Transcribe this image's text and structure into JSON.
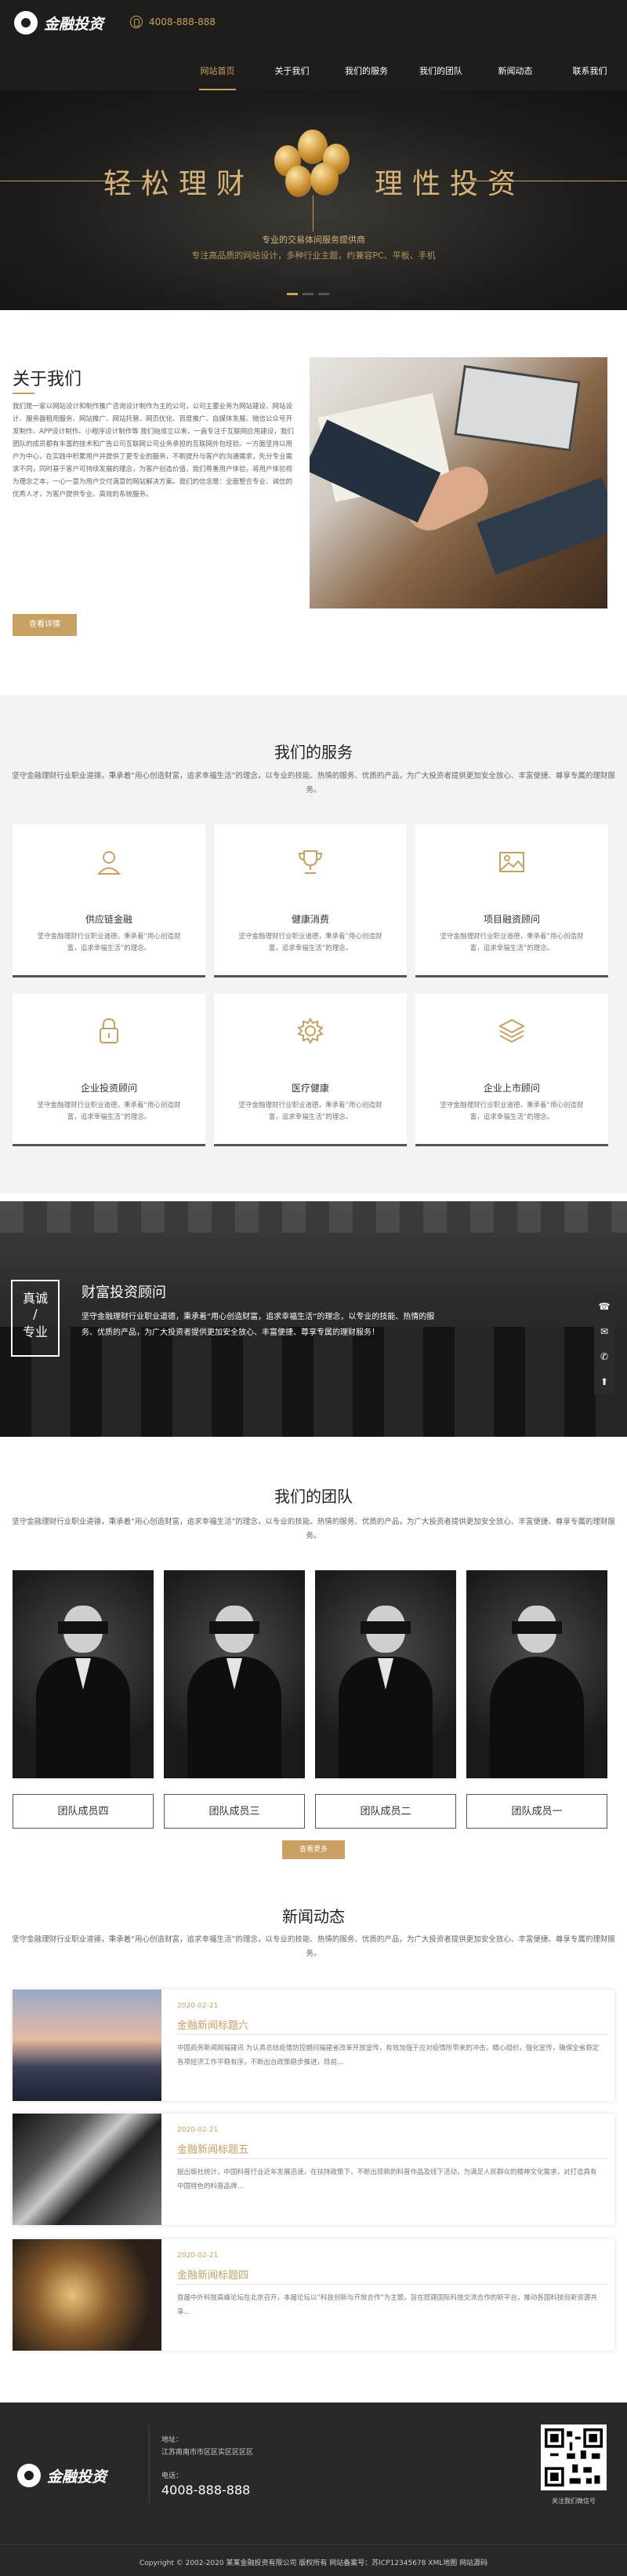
{
  "header": {
    "brand": "金融投资",
    "phone": "4008-888-888",
    "nav": [
      "网站首页",
      "关于我们",
      "我们的服务",
      "我们的团队",
      "新闻动态",
      "联系我们"
    ]
  },
  "banner": {
    "title_left": "轻松理财",
    "title_right": "理性投资",
    "sub1": "专业的交易体间服务提供商",
    "sub2": "专注高品质的网站设计，多种行业主题，约兼容PC、平板、手机"
  },
  "about": {
    "title": "关于我们",
    "text": "我们是一家以网站设计和制作推广咨询设计制作为主的公司，公司主要业务为网站建设、网站设计、服务器租用服务、网站推广、网站托管、网页优化、百度推广、自媒体发展、微信公众号开发制作、APP设计制作、小程序设计制作等 我们始成立以来，一直专注于互联网应用建设，我们团队的成员都有丰富的技术和广告公司互联网公司业务承担的互联网外包经验。一方面坚持以用户为中心，在实践中积累用户并提供了更专业的服务，不断提升与客户的沟通需求，先分专业需求不同，同时基于客户可持续发展的理念，为客户创造价值，我们尊重用户体验，将用户体验视为理念之本，一心一意为用户交付满意的网站解决方案。我们的信念是：全面整合专业、诚信的优秀人才，为客户提供专业、高效的系统服务。",
    "button": "查看详情"
  },
  "services": {
    "title": "我们的服务",
    "desc": "坚守金融理财行业职业道德，秉承着“用心创造财富，追求幸福生活”的理念，以专业的技能、热情的服务、优质的产品，为广大投资者提供更加安全放心、丰富便捷、尊享专属的理财服务。",
    "items": [
      {
        "title": "供应链金融",
        "icon": "user-icon",
        "desc": "坚守金融理财行业职业道德，秉承着“用心创造财富，追求幸福生活”的理念。"
      },
      {
        "title": "健康消费",
        "icon": "trophy-icon",
        "desc": "坚守金融理财行业职业道德，秉承着“用心创造财富，追求幸福生活”的理念。"
      },
      {
        "title": "项目融资顾问",
        "icon": "image-icon",
        "desc": "坚守金融理财行业职业道德，秉承着“用心创造财富，追求幸福生活”的理念。"
      },
      {
        "title": "企业投资顾问",
        "icon": "lock-icon",
        "desc": "坚守金融理财行业职业道德，秉承着“用心创造财富，追求幸福生活”的理念。"
      },
      {
        "title": "医疗健康",
        "icon": "gear-icon",
        "desc": "坚守金融理财行业职业道德，秉承着“用心创造财富，追求幸福生活”的理念。"
      },
      {
        "title": "企业上市顾问",
        "icon": "layers-icon",
        "desc": "坚守金融理财行业职业道德，秉承着“用心创造财富，追求幸福生活”的理念。"
      }
    ]
  },
  "feature": {
    "badge_top": "真诚",
    "badge_mid": "/",
    "badge_bottom": "专业",
    "title": "财富投资顾问",
    "text": "坚守金融理财行业职业道德，秉承着“用心创造财富，追求幸福生活”的理念，以专业的技能、热情的服务、优质的产品，为广大投资者提供更加安全放心、丰富便捷、尊享专属的理财服务！"
  },
  "team": {
    "title": "我们的团队",
    "desc": "坚守金融理财行业职业道德，秉承着“用心创造财富，追求幸福生活”的理念，以专业的技能、热情的服务、优质的产品，为广大投资者提供更加安全放心、丰富便捷、尊享专属的理财服务。",
    "members": [
      "团队成员四",
      "团队成员三",
      "团队成员二",
      "团队成员一"
    ],
    "button": "查看更多"
  },
  "news": {
    "title": "新闻动态",
    "desc": "坚守金融理财行业职业道德，秉承着“用心创造财富，追求幸福生活”的理念，以专业的技能、热情的服务、优质的产品，为广大投资者提供更加安全放心、丰富便捷、尊享专属的理财服务。",
    "items": [
      {
        "date": "2020-02-21",
        "title": "金融新闻标题六",
        "desc": "中国商务新闻网福建讯 为认真总结疫情防控期间福建省改革开放宣传，有效加强于应对疫情所带来的冲击，精心组织，强化宣传，确保全省稳定各项经济工作平稳有序，不断出台政策稳步推进，目前..."
      },
      {
        "date": "2020-02-21",
        "title": "金融新闻标题五",
        "desc": "据出版社统计，中国科普行业近年发展迅速，在扶持政策下，不断出现新的科普作品及线下活动，为满足人民群众的精神文化需求，对打造具有中国特色的科普品牌..."
      },
      {
        "date": "2020-02-21",
        "title": "金融新闻标题四",
        "desc": "首届中外科技高峰论坛在北京召开，本届论坛以“科技创新与开放合作”为主题，旨在搭建国际科技交流合作的新平台，推动各国科技创新资源共享..."
      }
    ]
  },
  "footer": {
    "brand": "金融投资",
    "address_label": "地址：",
    "address": "江苏南南市市区区实区区区区",
    "phone_label": "电话：",
    "phone": "4008-888-888",
    "qr_caption": "关注我们微信号",
    "copyright": "Copyright © 2002-2020 某某金融投资有限公司 版权所有 网站备案号：苏ICP12345678 XML地图 网站源码"
  },
  "sidebar": [
    "☎",
    "✉",
    "✆",
    "⬆"
  ]
}
